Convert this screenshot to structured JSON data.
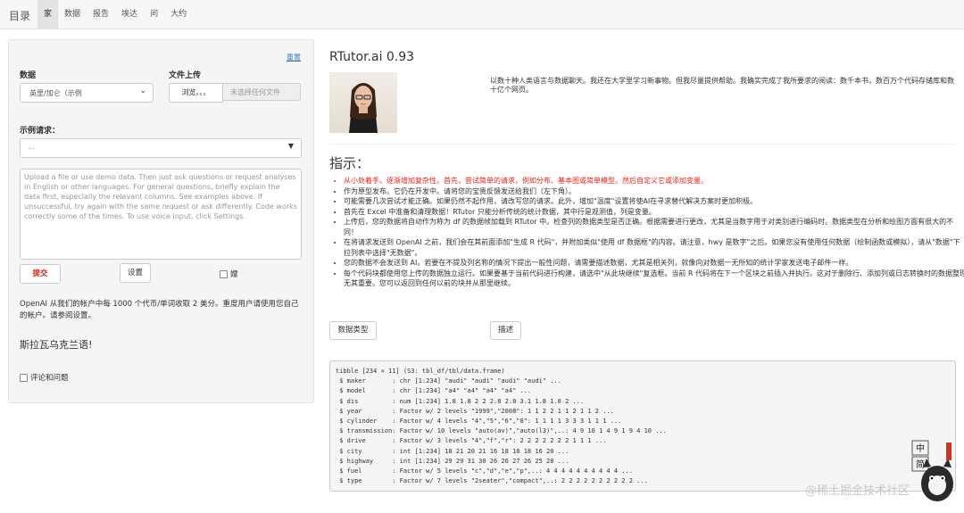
{
  "navbar": {
    "brand": "目录",
    "tabs": [
      "家",
      "数据",
      "报告",
      "埃达",
      "问",
      "大约"
    ],
    "active_tab": 0
  },
  "sidebar": {
    "reset_link": "重置",
    "data_label": "数据",
    "data_select_value": "英里/加仑（示例",
    "file_upload_label": "文件上传",
    "browse_button": "浏览。。。",
    "no_file_text": "未选择任何文件",
    "examples_label": "示例请求：",
    "examples_placeholder": "...",
    "textarea_placeholder": "Upload a file or use demo data. Then just ask questions or request analyses in English or other languages. For general questions, briefly explain the data first, especially the relevant columns. See examples above. If unsuccessful, try again with the same request or ask differently. Code works correctly some of the times. To use voice input, click Settings.",
    "submit_button": "提交",
    "settings_button": "设置",
    "voice_checkbox_label": "嫖",
    "note": "OpenAI 从我们的帐户中每 1000 个代币/单词收取 2 美分。重度用户请使用您自己的帐户。请参阅设置。",
    "language_text": "斯拉瓦乌克兰语!",
    "feedback_checkbox_label": "评论和问题"
  },
  "main": {
    "title": "RTutor.ai 0.93",
    "intro": "以数十种人类语言与数据聊天。我还在大学里学习新事物。但我尽量提供帮助。我确实完成了我所要求的阅读：数千本书，数百万个代码存储库和数十亿个网页。",
    "instructions_title": "指示：",
    "instructions": [
      {
        "text": "从小处着手。逐渐增加复杂性。首先，尝试简单的请求，例如分布、基本图或简单模型。然后自定义它或添加变量。",
        "color": "#e62417"
      },
      {
        "text": "作为原型发布。它仍在开发中。请将您的宝贵反馈发送给我们（左下角）。"
      },
      {
        "text": "可能需要几次尝试才能正确。如果仍然不起作用，请改写您的请求。此外，增加\"温度\"设置将使AI在寻求替代解决方案时更加积极。"
      },
      {
        "text": "首先在 Excel 中准备和清理数据！RTutor 只能分析传统的统计数据，其中行是观测值，列是变量。"
      },
      {
        "text": "上传后，您的数据将自动作为称为 df 的数据帧加载到 RTutor 中。检查列的数据类型是否正确。根据需要进行更改，尤其是当数字用于对类别进行编码时。数据类型在分析和绘图方面有很大的不同！"
      },
      {
        "text": "在将请求发送到 OpenAI 之前，我们会在其前面添加\"生成 R 代码\"，并附加类似\"使用 df 数据框\"的内容。请注意，hwy 是数字\"之后。如果您没有使用任何数据（绘制函数或模拟），请从\"数据\"下拉列表中选择\"无数据\"。"
      },
      {
        "text": "您的数据不会发送到 AI。若要在不提及列名称的情况下提出一般性问题，请需要描述数据，尤其是相关列，就像向对数据一无所知的统计学家发送电子邮件一样。"
      },
      {
        "text": "每个代码块都使用您上传的数据独立运行。如果要基于当前代码进行构建，请选中\"从此块继续\"复选框。当前 R 代码将在下一个区块之前插入并执行。这对于删除行、添加列或日志转换时的数据整理无其重要。您可以返回到任何以前的块并从那里继续。"
      }
    ],
    "data_types_button": "数据类型",
    "describe_button": "描述",
    "output_lines": [
      "tibble [234 × 11] (S3: tbl_df/tbl/data.frame)",
      " $ maker       : chr [1:234] \"audi\" \"audi\" \"audi\" \"audi\" ...",
      " $ model       : chr [1:234] \"a4\" \"a4\" \"a4\" \"a4\" ...",
      " $ dis         : num [1:234] 1.8 1.8 2 2 2.8 2.8 3.1 1.8 1.8 2 ...",
      " $ year        : Factor w/ 2 levels \"1999\",\"2008\": 1 1 2 2 1 1 2 1 1 2 ...",
      " $ cylinder    : Factor w/ 4 levels \"4\",\"5\",\"6\",\"8\": 1 1 1 1 3 3 3 1 1 1 ...",
      " $ transmission: Factor w/ 10 levels \"auto(av)\",\"auto(l3)\",..: 4 9 10 1 4 9 1 9 4 10 ...",
      " $ drive       : Factor w/ 3 levels \"4\",\"f\",\"r\": 2 2 2 2 2 2 2 1 1 1 ...",
      " $ city        : int [1:234] 18 21 20 21 16 18 18 18 16 20 ...",
      " $ highway     : int [1:234] 29 29 31 30 26 26 27 26 25 28 ...",
      " $ fuel        : Factor w/ 5 levels \"c\",\"d\",\"e\",\"p\",..: 4 4 4 4 4 4 4 4 4 4 ...",
      " $ type        : Factor w/ 7 levels \"2seater\",\"compact\",..: 2 2 2 2 2 2 2 2 2 2 ..."
    ]
  },
  "watermark": "@稀土掘金技术社区",
  "mascot_text": [
    "中",
    "简"
  ],
  "colors": {
    "accent_red": "#d9230f",
    "link": "#337ab7"
  }
}
